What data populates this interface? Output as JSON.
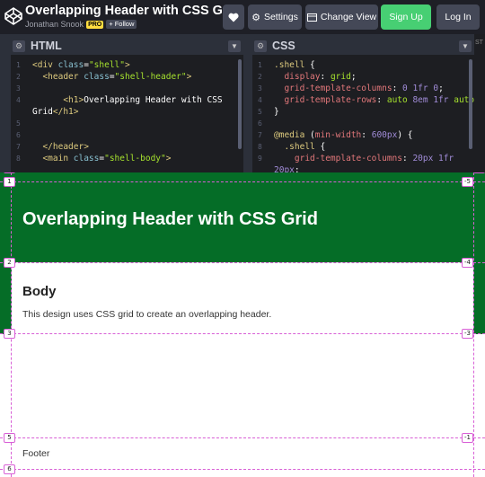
{
  "topbar": {
    "title": "Overlapping Header with CSS Grid",
    "author": "Jonathan Snook",
    "pro_label": "PRO",
    "follow_label": "+ Follow",
    "heart_icon": "heart-icon",
    "settings_label": "Settings",
    "change_view_label": "Change View",
    "signup_label": "Sign Up",
    "login_label": "Log In",
    "accent_green": "#47cf73",
    "button_bg": "#444857"
  },
  "editors": {
    "html_title": "HTML",
    "css_title": "CSS",
    "html_lines": [
      {
        "n": "1",
        "parts": [
          {
            "c": "tag",
            "t": "<div "
          },
          {
            "c": "attr",
            "t": "class"
          },
          {
            "c": "punc",
            "t": "="
          },
          {
            "c": "str",
            "t": "\"shell\""
          },
          {
            "c": "tag",
            "t": ">"
          }
        ]
      },
      {
        "n": "2",
        "parts": [
          {
            "c": "tag",
            "t": "  <header "
          },
          {
            "c": "attr",
            "t": "class"
          },
          {
            "c": "punc",
            "t": "="
          },
          {
            "c": "str",
            "t": "\"shell-header\""
          },
          {
            "c": "tag",
            "t": ">"
          }
        ]
      },
      {
        "n": "3",
        "parts": []
      },
      {
        "n": "4",
        "parts": [
          {
            "c": "tag",
            "t": "      <h1>"
          },
          {
            "c": "txt",
            "t": "Overlapping Header with CSS"
          }
        ]
      },
      {
        "n": "",
        "parts": [
          {
            "c": "txt",
            "t": "Grid"
          },
          {
            "c": "tag",
            "t": "</h1>"
          }
        ]
      },
      {
        "n": "5",
        "parts": []
      },
      {
        "n": "6",
        "parts": []
      },
      {
        "n": "7",
        "parts": [
          {
            "c": "tag",
            "t": "  </header>"
          }
        ]
      },
      {
        "n": "8",
        "parts": [
          {
            "c": "tag",
            "t": "  <main "
          },
          {
            "c": "attr",
            "t": "class"
          },
          {
            "c": "punc",
            "t": "="
          },
          {
            "c": "str",
            "t": "\"shell-body\""
          },
          {
            "c": "tag",
            "t": ">"
          }
        ]
      }
    ],
    "css_lines": [
      {
        "n": "1",
        "parts": [
          {
            "c": "sel",
            "t": ".shell "
          },
          {
            "c": "punc",
            "t": "{"
          }
        ]
      },
      {
        "n": "2",
        "parts": [
          {
            "c": "prop",
            "t": "  display"
          },
          {
            "c": "punc",
            "t": ": "
          },
          {
            "c": "val",
            "t": "grid"
          },
          {
            "c": "punc",
            "t": ";"
          }
        ]
      },
      {
        "n": "3",
        "parts": [
          {
            "c": "prop",
            "t": "  grid-template-columns"
          },
          {
            "c": "punc",
            "t": ": "
          },
          {
            "c": "num",
            "t": "0 1fr 0"
          },
          {
            "c": "punc",
            "t": ";"
          }
        ]
      },
      {
        "n": "4",
        "parts": [
          {
            "c": "prop",
            "t": "  grid-template-rows"
          },
          {
            "c": "punc",
            "t": ": "
          },
          {
            "c": "val",
            "t": "auto "
          },
          {
            "c": "num",
            "t": "8em 1fr"
          },
          {
            "c": "val",
            "t": " auto"
          },
          {
            "c": "punc",
            "t": ";"
          }
        ]
      },
      {
        "n": "5",
        "parts": [
          {
            "c": "punc",
            "t": "}"
          }
        ]
      },
      {
        "n": "6",
        "parts": []
      },
      {
        "n": "7",
        "parts": [
          {
            "c": "at",
            "t": "@media "
          },
          {
            "c": "punc",
            "t": "("
          },
          {
            "c": "prop",
            "t": "min-width"
          },
          {
            "c": "punc",
            "t": ": "
          },
          {
            "c": "num",
            "t": "600px"
          },
          {
            "c": "punc",
            "t": ") {"
          }
        ]
      },
      {
        "n": "8",
        "parts": [
          {
            "c": "sel",
            "t": "  .shell "
          },
          {
            "c": "punc",
            "t": "{"
          }
        ]
      },
      {
        "n": "9",
        "parts": [
          {
            "c": "prop",
            "t": "    grid-template-columns"
          },
          {
            "c": "punc",
            "t": ": "
          },
          {
            "c": "num",
            "t": "20px 1fr"
          }
        ]
      },
      {
        "n": "",
        "parts": [
          {
            "c": "num",
            "t": "20px"
          },
          {
            "c": "punc",
            "t": ";"
          }
        ]
      }
    ],
    "side_label": "ST"
  },
  "preview": {
    "header_title": "Overlapping Header with CSS Grid",
    "body_heading": "Body",
    "body_text": "This design uses CSS grid to create an overlapping header.",
    "footer_text": "Footer",
    "header_color": "#056d27",
    "grid_line_color": "#d85fd6",
    "grid_badges": [
      "2",
      "4",
      "1",
      "-5",
      "2",
      "-4",
      "3",
      "-3",
      "5",
      "-1",
      "6"
    ]
  }
}
